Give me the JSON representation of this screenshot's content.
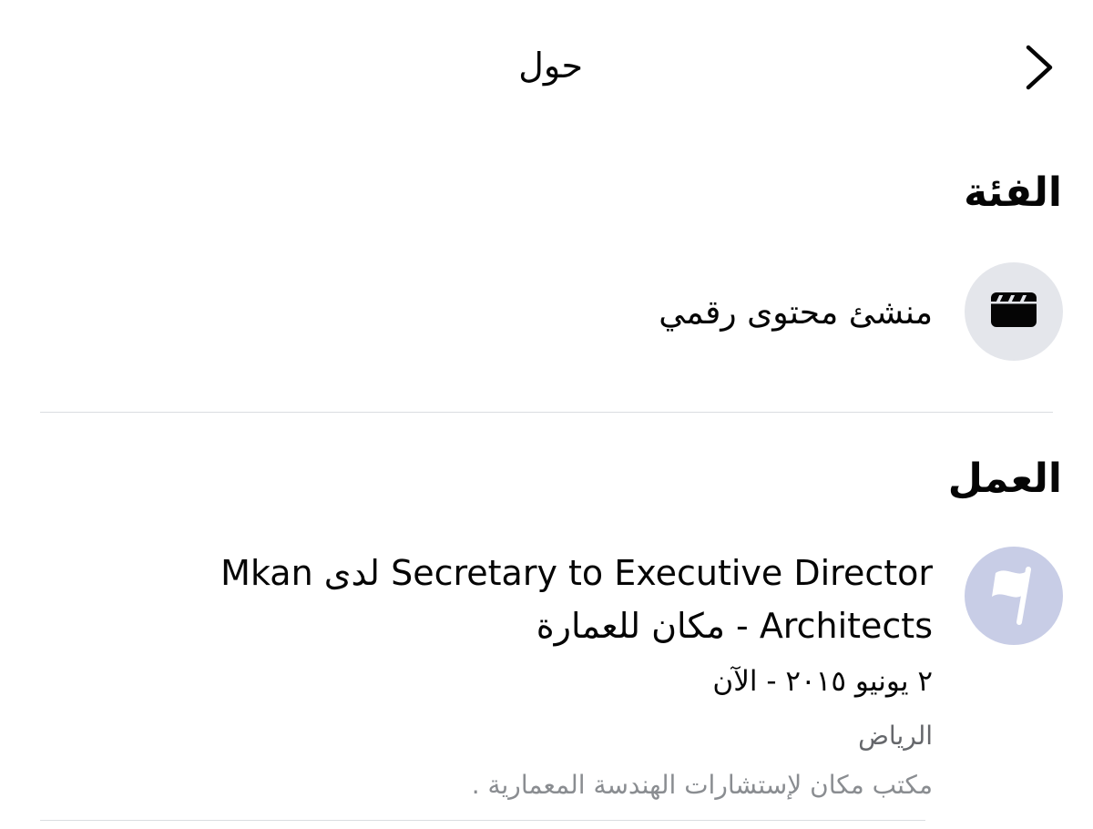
{
  "header": {
    "title": "حول",
    "back_icon": "chevron-right-icon"
  },
  "category": {
    "heading": "الفئة",
    "icon": "clapperboard-icon",
    "value": "منشئ محتوى رقمي"
  },
  "work": {
    "heading": "العمل",
    "icon": "flag-icon",
    "title": "Secretary to Executive Director لدى Mkan Architects - مكان للعمارة",
    "dates": "٢ يونيو ٢٠١٥ - الآن",
    "location": "الرياض",
    "description": "مكتب مكان لإستشارات الهندسة المعمارية ."
  },
  "colors": {
    "text_primary": "#050505",
    "text_secondary": "#65676b",
    "icon_bg": "#e4e6eb",
    "flag_bg": "#c8cde6"
  }
}
